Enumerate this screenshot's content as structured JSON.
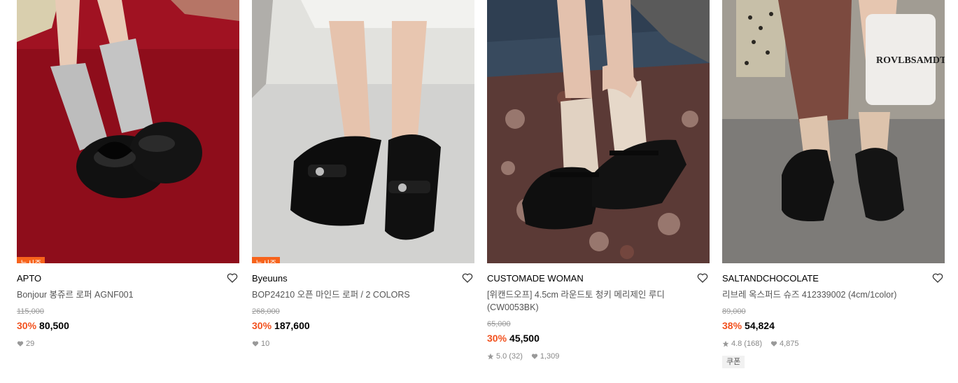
{
  "products": [
    {
      "badge": "뉴시즌",
      "brand": "APTO",
      "title": "Bonjour 봉쥬르 로퍼 AGNF001",
      "original_price": "115,000",
      "discount": "30%",
      "price": "80,500",
      "likes": "29",
      "image_desc": "black patent loafer with bow, grey socks, red carpet"
    },
    {
      "badge": "뉴시즌",
      "brand": "Byeuuns",
      "title": "BOP24210 오픈 마인드 로퍼 / 2 COLORS",
      "original_price": "268,000",
      "discount": "30%",
      "price": "187,600",
      "likes": "10",
      "image_desc": "black penny loafers on grey floor"
    },
    {
      "brand": "CUSTOMADE WOMAN",
      "title_line1": "[위캔드오프] 4.5cm 라운드토 청키 메리제인 루디",
      "title_line2": "(CW0053BK)",
      "original_price": "65,000",
      "discount": "30%",
      "price": "45,500",
      "rating": "5.0",
      "reviews": "(32)",
      "likes": "1,309",
      "image_desc": "black mary jane shoes with beige socks on patterned rug"
    },
    {
      "brand": "SALTANDCHOCOLATE",
      "title": "리브레 옥스퍼드 슈즈 412339002 (4cm/1color)",
      "original_price": "89,000",
      "discount": "38%",
      "price": "54,824",
      "rating": "4.8",
      "reviews": "(168)",
      "likes": "4,875",
      "coupon": "쿠폰",
      "image_desc": "black lace-up oxford shoes with beige socks on stone pavement"
    }
  ],
  "colors": {
    "discount": "#f2521f",
    "badge": "#f7631b"
  }
}
